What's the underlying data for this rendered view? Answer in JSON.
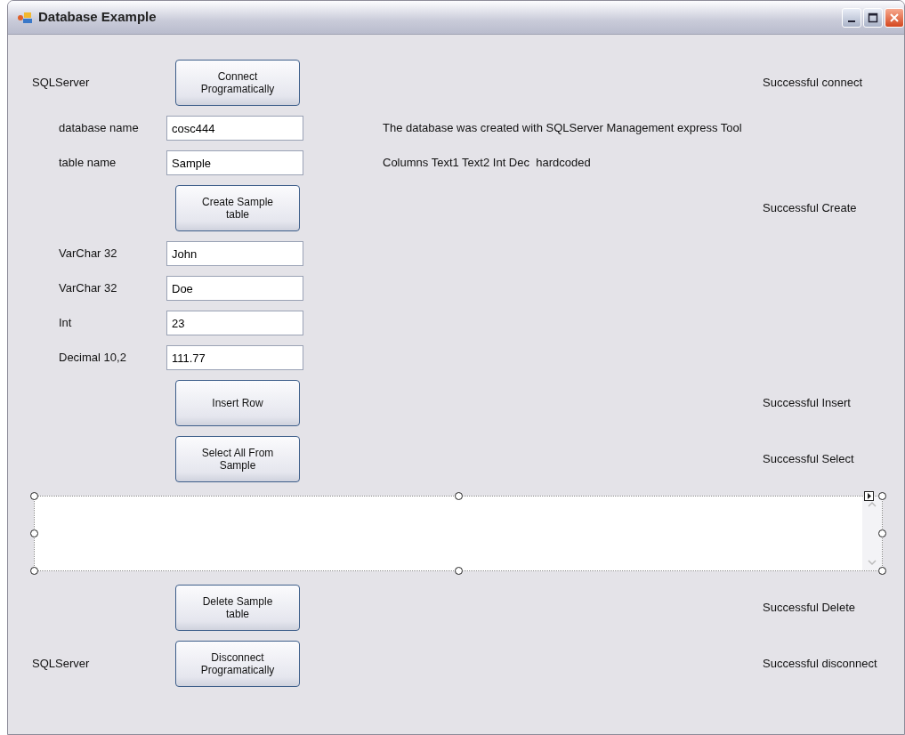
{
  "window": {
    "title": "Database Example"
  },
  "rows": [
    {
      "kind": "button",
      "label": "SQLServer",
      "button": "Connect Programatically",
      "status": "Successful connect"
    },
    {
      "kind": "field",
      "label": "database name",
      "value": "cosc444",
      "note": "The database was created with SQLServer Management express Tool"
    },
    {
      "kind": "field",
      "label": "table name",
      "value": "Sample",
      "note": "Columns Text1 Text2 Int Dec  hardcoded"
    },
    {
      "kind": "button",
      "button": "Create Sample table",
      "status": "Successful Create"
    },
    {
      "kind": "field",
      "label": "VarChar 32",
      "value": "John"
    },
    {
      "kind": "field",
      "label": "VarChar 32",
      "value": "Doe"
    },
    {
      "kind": "field",
      "label": "Int",
      "value": "23"
    },
    {
      "kind": "field",
      "label": "Decimal 10,2",
      "value": "111.77"
    },
    {
      "kind": "button",
      "button": "Insert Row",
      "status": "Successful Insert"
    },
    {
      "kind": "button",
      "button": "Select All From Sample",
      "status": "Successful Select"
    },
    {
      "kind": "listbox"
    },
    {
      "kind": "button",
      "button": "Delete Sample table",
      "status": "Successful Delete"
    },
    {
      "kind": "button",
      "label": "SQLServer",
      "button": "Disconnect Programatically",
      "status": "Successful disconnect"
    }
  ]
}
